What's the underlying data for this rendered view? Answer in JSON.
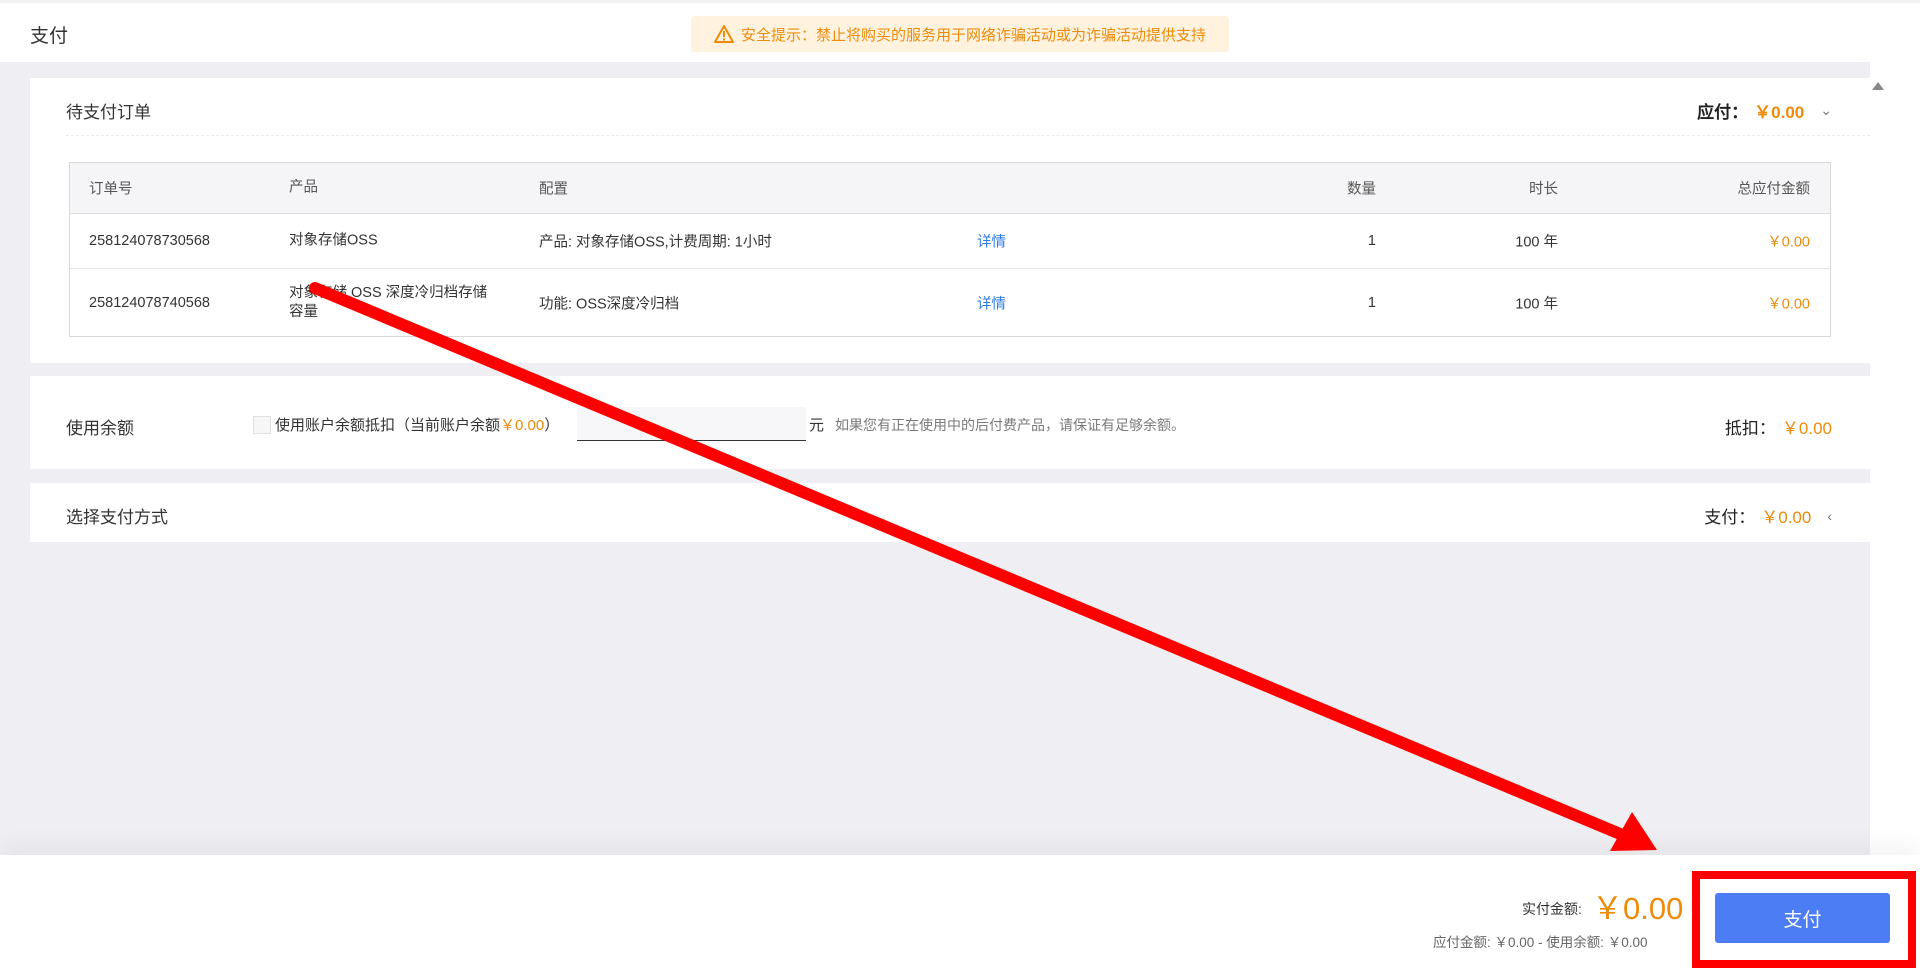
{
  "page": {
    "title": "支付"
  },
  "notice": {
    "text": "安全提示：禁止将购买的服务用于网络诈骗活动或为诈骗活动提供支持",
    "icon": "warning-icon"
  },
  "orders_card": {
    "title": "待支付订单",
    "payable_label": "应付：",
    "payable_amount": "￥0.00",
    "columns": [
      "订单号",
      "产品",
      "配置",
      "数量",
      "时长",
      "总应付金额"
    ],
    "rows": [
      {
        "order_no": "258124078730568",
        "product": "对象存储OSS",
        "config": "产品: 对象存储OSS,计费周期: 1小时",
        "detail": "详情",
        "qty": "1",
        "duration": "100 年",
        "total": "￥0.00"
      },
      {
        "order_no": "258124078740568",
        "product": "对象存储 OSS 深度冷归档存储容量",
        "config": "功能: OSS深度冷归档",
        "detail": "详情",
        "qty": "1",
        "duration": "100 年",
        "total": "￥0.00"
      }
    ]
  },
  "balance_card": {
    "title": "使用余额",
    "checkbox_label": "使用账户余额抵扣（当前账户余额",
    "current_balance": "￥0.00",
    "checkbox_close": "）",
    "input_value": "",
    "unit": "元",
    "hint": "如果您有正在使用中的后付费产品，请保证有足够余额。",
    "deduct_label": "抵扣：",
    "deduct_amount": "￥0.00"
  },
  "payment_card": {
    "title": "选择支付方式",
    "pay_label": "支付：",
    "pay_amount": "￥0.00"
  },
  "footer": {
    "actual_label": "实付金额:",
    "actual_amount": "￥0.00",
    "breakdown": "应付金额: ￥0.00 - 使用余额: ￥0.00",
    "pay_button": "支付"
  },
  "colors": {
    "accent": "#ef8b0b",
    "primary_button": "#4d7df5",
    "link": "#2f7be8",
    "annotation": "#ff0000"
  }
}
